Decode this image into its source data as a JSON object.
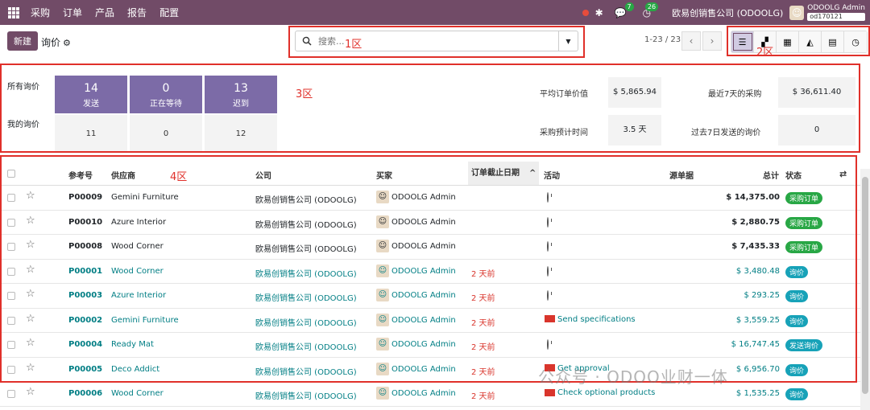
{
  "topbar": {
    "app": "采购",
    "menu": [
      "订单",
      "产品",
      "报告",
      "配置"
    ],
    "msg_count": "7",
    "act_count": "26",
    "company": "欧易创销售公司 (ODOOLG)",
    "user": "ODOOLG Admin",
    "db": "od170121"
  },
  "control": {
    "new_label": "新建",
    "title": "询价",
    "search_placeholder": "搜索...",
    "pager": "1-23 / 23"
  },
  "zones": {
    "z1": "1区",
    "z2": "2区",
    "z3": "3区",
    "z4": "4区"
  },
  "dashboard": {
    "row1_label": "所有询价",
    "row2_label": "我的询价",
    "big": [
      {
        "n": "14",
        "l": "发送"
      },
      {
        "n": "0",
        "l": "正在等待"
      },
      {
        "n": "13",
        "l": "迟到"
      }
    ],
    "small": [
      "11",
      "0",
      "12"
    ],
    "kpis": [
      {
        "label": "平均订单价值",
        "value": "$ 5,865.94"
      },
      {
        "label": "最近7天的采购",
        "value": "$ 36,611.40"
      },
      {
        "label": "采购预计时间",
        "value": "3.5 天"
      },
      {
        "label": "过去7日发送的询价",
        "value": "0"
      }
    ]
  },
  "table": {
    "headers": {
      "ref": "参考号",
      "vendor": "供应商",
      "company": "公司",
      "buyer": "买家",
      "deadline": "订单截止日期",
      "activity": "活动",
      "source": "源单据",
      "total": "总计",
      "status": "状态"
    },
    "rows": [
      {
        "ref": "P00009",
        "vendor": "Gemini Furniture",
        "company": "欧易创销售公司 (ODOOLG)",
        "buyer": "ODOOLG Admin",
        "deadline": "",
        "activity": "",
        "total": "$ 14,375.00",
        "status": "采购订单"
      },
      {
        "ref": "P00010",
        "vendor": "Azure Interior",
        "company": "欧易创销售公司 (ODOOLG)",
        "buyer": "ODOOLG Admin",
        "deadline": "",
        "activity": "",
        "total": "$ 2,880.75",
        "status": "采购订单"
      },
      {
        "ref": "P00008",
        "vendor": "Wood Corner",
        "company": "欧易创销售公司 (ODOOLG)",
        "buyer": "ODOOLG Admin",
        "deadline": "",
        "activity": "",
        "total": "$ 7,435.33",
        "status": "采购订单"
      },
      {
        "ref": "P00001",
        "vendor": "Wood Corner",
        "company": "欧易创销售公司 (ODOOLG)",
        "buyer": "ODOOLG Admin",
        "deadline": "2 天前",
        "activity": "",
        "total": "$ 3,480.48",
        "status": "询价"
      },
      {
        "ref": "P00003",
        "vendor": "Azure Interior",
        "company": "欧易创销售公司 (ODOOLG)",
        "buyer": "ODOOLG Admin",
        "deadline": "2 天前",
        "activity": "",
        "total": "$ 293.25",
        "status": "询价"
      },
      {
        "ref": "P00002",
        "vendor": "Gemini Furniture",
        "company": "欧易创销售公司 (ODOOLG)",
        "buyer": "ODOOLG Admin",
        "deadline": "2 天前",
        "activity": "Send specifications",
        "total": "$ 3,559.25",
        "status": "询价"
      },
      {
        "ref": "P00004",
        "vendor": "Ready Mat",
        "company": "欧易创销售公司 (ODOOLG)",
        "buyer": "ODOOLG Admin",
        "deadline": "2 天前",
        "activity": "",
        "total": "$ 16,747.45",
        "status": "发送询价"
      },
      {
        "ref": "P00005",
        "vendor": "Deco Addict",
        "company": "欧易创销售公司 (ODOOLG)",
        "buyer": "ODOOLG Admin",
        "deadline": "2 天前",
        "activity": "Get approval",
        "total": "$ 6,956.70",
        "status": "询价"
      },
      {
        "ref": "P00006",
        "vendor": "Wood Corner",
        "company": "欧易创销售公司 (ODOOLG)",
        "buyer": "ODOOLG Admin",
        "deadline": "2 天前",
        "activity": "Check optional products",
        "total": "$ 1,535.25",
        "status": "询价"
      }
    ]
  },
  "watermark": "公众号 · ODOO业财一体"
}
